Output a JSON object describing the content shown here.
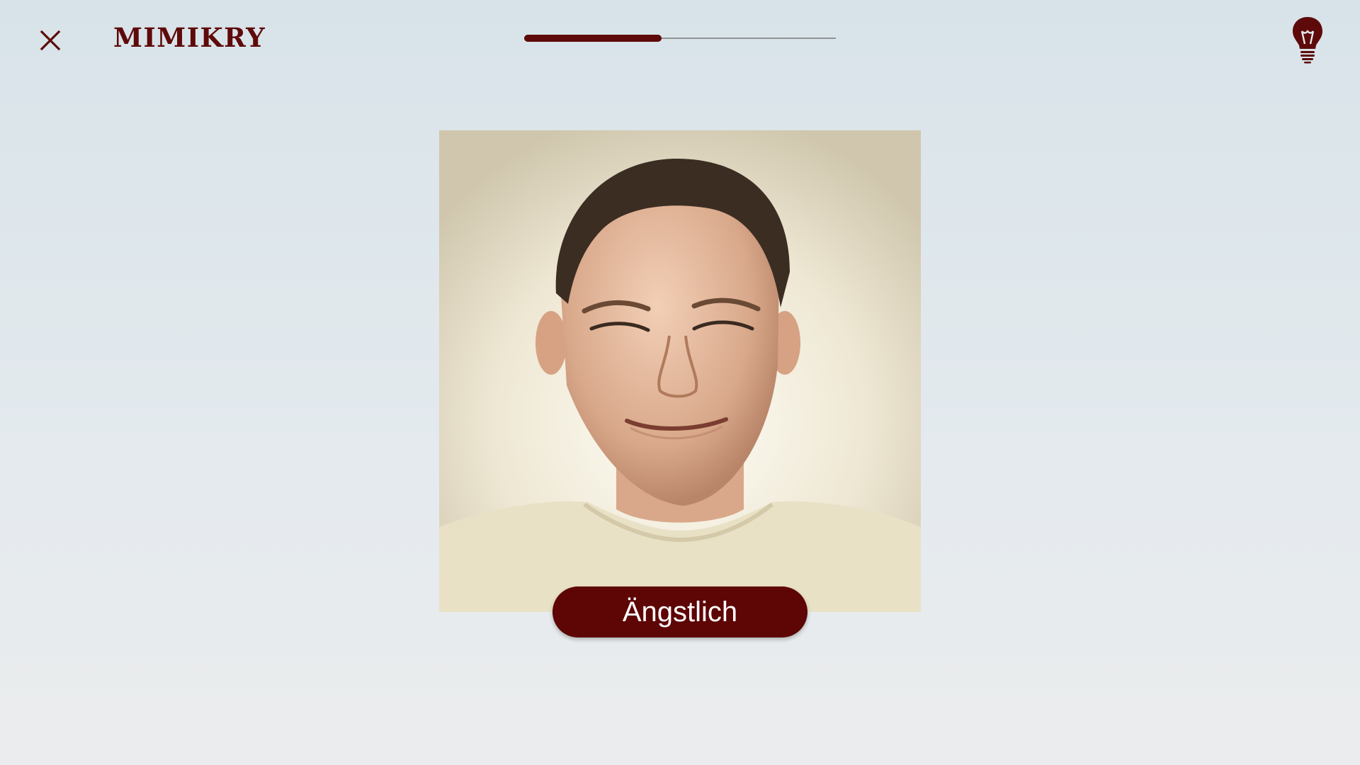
{
  "header": {
    "app_title": "MIMIKRY",
    "close_icon": "close-icon",
    "hint_icon": "lightbulb-icon"
  },
  "progress": {
    "value": 0.44
  },
  "card": {
    "image": "face-photo",
    "answer_label": "Ängstlich"
  },
  "colors": {
    "accent": "#5e0a0a",
    "pill": "#5e0505",
    "background": "#dde6eb"
  }
}
